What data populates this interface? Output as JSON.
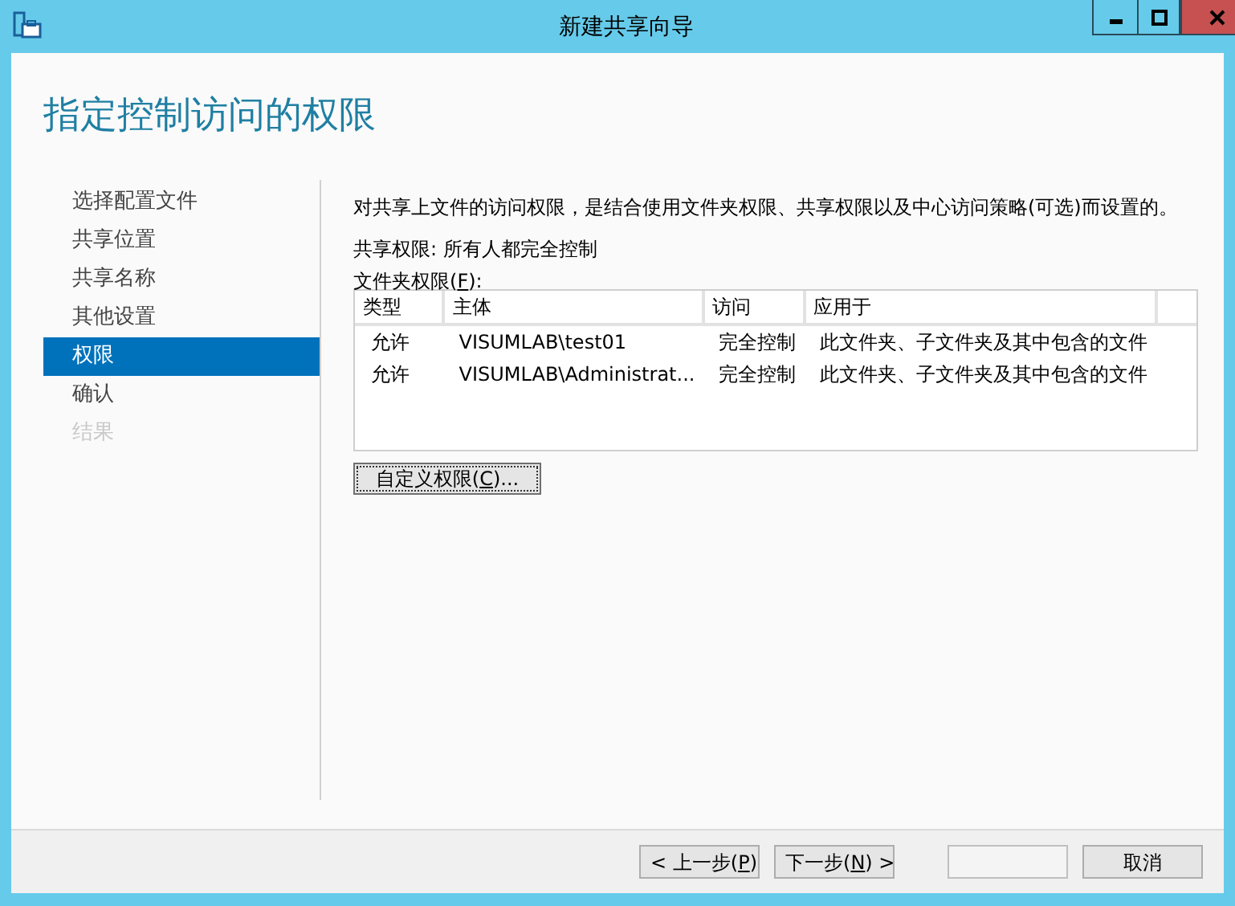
{
  "window": {
    "title": "新建共享向导"
  },
  "heading": "指定控制访问的权限",
  "steps": [
    {
      "label": "选择配置文件",
      "selected": false,
      "disabled": false
    },
    {
      "label": "共享位置",
      "selected": false,
      "disabled": false
    },
    {
      "label": "共享名称",
      "selected": false,
      "disabled": false
    },
    {
      "label": "其他设置",
      "selected": false,
      "disabled": false
    },
    {
      "label": "权限",
      "selected": true,
      "disabled": false
    },
    {
      "label": "确认",
      "selected": false,
      "disabled": false
    },
    {
      "label": "结果",
      "selected": false,
      "disabled": true
    }
  ],
  "description": "对共享上文件的访问权限，是结合使用文件夹权限、共享权限以及中心访问策略(可选)而设置的。",
  "share_permissions": "共享权限: 所有人都完全控制",
  "folder_permissions_label": {
    "before": "文件夹权限(",
    "access_key": "F",
    "after": "):"
  },
  "table": {
    "columns": [
      "类型",
      "主体",
      "访问",
      "应用于"
    ],
    "rows": [
      [
        "允许",
        "VISUMLAB\\test01",
        "完全控制",
        "此文件夹、子文件夹及其中包含的文件"
      ],
      [
        "允许",
        "VISUMLAB\\Administrat...",
        "完全控制",
        "此文件夹、子文件夹及其中包含的文件"
      ]
    ]
  },
  "customize_button": {
    "before": "自定义权限(",
    "access_key": "C",
    "after": ")..."
  },
  "footer_buttons": [
    {
      "kind": "back",
      "before": "< 上一步(",
      "access_key": "P",
      "after": ")",
      "disabled": false
    },
    {
      "kind": "next",
      "before": "下一步(",
      "access_key": "N",
      "after": ") >",
      "disabled": false
    },
    {
      "kind": "create",
      "disabled": true
    },
    {
      "kind": "cancel",
      "before": "取消",
      "disabled": false
    }
  ]
}
